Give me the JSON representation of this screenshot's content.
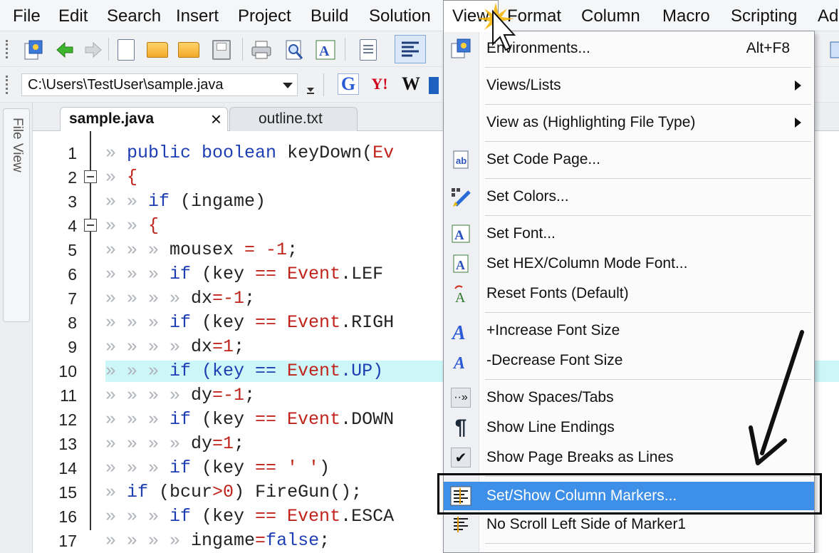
{
  "menubar": {
    "items": [
      {
        "label": "File"
      },
      {
        "label": "Edit"
      },
      {
        "label": "Search"
      },
      {
        "label": "Insert"
      },
      {
        "label": "Project"
      },
      {
        "label": "Build"
      },
      {
        "label": "Solution"
      },
      {
        "label": "View"
      },
      {
        "label": "Format"
      },
      {
        "label": "Column"
      },
      {
        "label": "Macro"
      },
      {
        "label": "Scripting"
      },
      {
        "label": "Ad"
      }
    ]
  },
  "toolbar2": {
    "path": "C:\\Users\\TestUser\\sample.java",
    "search_buttons": [
      "G",
      "Y!",
      "W"
    ]
  },
  "sidepanel": {
    "label": "File View"
  },
  "tabs": [
    {
      "label": "sample.java",
      "close": "×"
    },
    {
      "label": "outline.txt"
    }
  ],
  "editor": {
    "lines": [
      {
        "n": "1",
        "parts": [
          [
            "w",
            "» "
          ],
          [
            "k",
            "public boolean "
          ],
          [
            "n",
            "keyDown("
          ],
          [
            "r",
            "Ev"
          ]
        ]
      },
      {
        "n": "2",
        "parts": [
          [
            "w",
            "» "
          ],
          [
            "r",
            "{"
          ]
        ]
      },
      {
        "n": "3",
        "parts": [
          [
            "w",
            "» » "
          ],
          [
            "k",
            "if "
          ],
          [
            "n",
            "(ingame)"
          ]
        ]
      },
      {
        "n": "4",
        "parts": [
          [
            "w",
            "» » "
          ],
          [
            "r",
            "{"
          ]
        ]
      },
      {
        "n": "5",
        "parts": [
          [
            "w",
            "» » » "
          ],
          [
            "n",
            "mousex "
          ],
          [
            "r",
            "= -1"
          ],
          [
            "n",
            ";"
          ]
        ]
      },
      {
        "n": "6",
        "parts": [
          [
            "w",
            "» » » "
          ],
          [
            "k",
            "if "
          ],
          [
            "n",
            "(key "
          ],
          [
            "r",
            "== Event"
          ],
          [
            "n",
            ".LEF"
          ]
        ]
      },
      {
        "n": "7",
        "parts": [
          [
            "w",
            "» » » » "
          ],
          [
            "n",
            "dx"
          ],
          [
            "r",
            "=-1"
          ],
          [
            "n",
            ";"
          ]
        ]
      },
      {
        "n": "8",
        "parts": [
          [
            "w",
            "» » » "
          ],
          [
            "k",
            "if "
          ],
          [
            "n",
            "(key "
          ],
          [
            "r",
            "== Event"
          ],
          [
            "n",
            ".RIGH"
          ]
        ]
      },
      {
        "n": "9",
        "parts": [
          [
            "w",
            "» » » » "
          ],
          [
            "n",
            "dx"
          ],
          [
            "r",
            "=1"
          ],
          [
            "n",
            ";"
          ]
        ]
      },
      {
        "n": "10",
        "parts": [
          [
            "w",
            "» » » "
          ],
          [
            "k",
            "if (key == "
          ],
          [
            "r",
            "Event"
          ],
          [
            "k",
            ".UP)"
          ]
        ]
      },
      {
        "n": "11",
        "parts": [
          [
            "w",
            "» » » » "
          ],
          [
            "n",
            "dy"
          ],
          [
            "r",
            "=-1"
          ],
          [
            "n",
            ";"
          ]
        ]
      },
      {
        "n": "12",
        "parts": [
          [
            "w",
            "» » » "
          ],
          [
            "k",
            "if "
          ],
          [
            "n",
            "(key "
          ],
          [
            "r",
            "== Event"
          ],
          [
            "n",
            ".DOWN"
          ]
        ]
      },
      {
        "n": "13",
        "parts": [
          [
            "w",
            "» » » » "
          ],
          [
            "n",
            "dy"
          ],
          [
            "r",
            "=1"
          ],
          [
            "n",
            ";"
          ]
        ]
      },
      {
        "n": "14",
        "parts": [
          [
            "w",
            "» » » "
          ],
          [
            "k",
            "if "
          ],
          [
            "n",
            "(key "
          ],
          [
            "r",
            "== ' '"
          ],
          [
            "n",
            ")"
          ]
        ]
      },
      {
        "n": "15",
        "parts": [
          [
            "w",
            "» "
          ],
          [
            "k",
            "if "
          ],
          [
            "n",
            "(bcur"
          ],
          [
            "r",
            ">0"
          ],
          [
            "n",
            ") FireGun();"
          ]
        ]
      },
      {
        "n": "16",
        "parts": [
          [
            "w",
            "» » » "
          ],
          [
            "k",
            "if "
          ],
          [
            "n",
            "(key "
          ],
          [
            "r",
            "== Event"
          ],
          [
            "n",
            ".ESCA"
          ]
        ]
      },
      {
        "n": "17",
        "parts": [
          [
            "w",
            "» » » » "
          ],
          [
            "n",
            "ingame"
          ],
          [
            "r",
            "="
          ],
          [
            "k",
            "false"
          ],
          [
            "n",
            ";"
          ]
        ]
      }
    ]
  },
  "view_menu": {
    "items": [
      {
        "label": "Environments...",
        "shortcut": "Alt+F8",
        "icon": "environments-icon"
      },
      {
        "label": "Views/Lists",
        "submenu": true
      },
      {
        "label": "View as (Highlighting File Type)",
        "submenu": true
      },
      {
        "label": "Set Code Page...",
        "icon": "code-page-icon"
      },
      {
        "label": "Set Colors...",
        "icon": "colors-icon"
      },
      {
        "label": "Set Font...",
        "icon": "font-icon"
      },
      {
        "label": "Set HEX/Column Mode Font...",
        "icon": "hex-font-icon"
      },
      {
        "label": "Reset Fonts (Default)",
        "icon": "reset-fonts-icon"
      },
      {
        "label": "+Increase Font Size",
        "icon": "increase-font-icon"
      },
      {
        "label": "-Decrease Font Size",
        "icon": "decrease-font-icon"
      },
      {
        "label": "Show Spaces/Tabs",
        "icon": "spaces-tabs-icon"
      },
      {
        "label": "Show Line Endings",
        "icon": "pilcrow-icon"
      },
      {
        "label": "Show Page Breaks as Lines",
        "icon": "check-icon"
      },
      {
        "label": "Set/Show Column Markers...",
        "icon": "column-markers-icon",
        "active": true
      },
      {
        "label": "No Scroll Left Side of Marker1",
        "icon": "no-scroll-icon"
      }
    ]
  },
  "colors": {
    "keyword": "#1e3fb4",
    "operator": "#c0231b",
    "whitespace_marker": "#b0b4ba",
    "current_line": "#cdf6f9",
    "menu_highlight": "#3e8fe8"
  }
}
